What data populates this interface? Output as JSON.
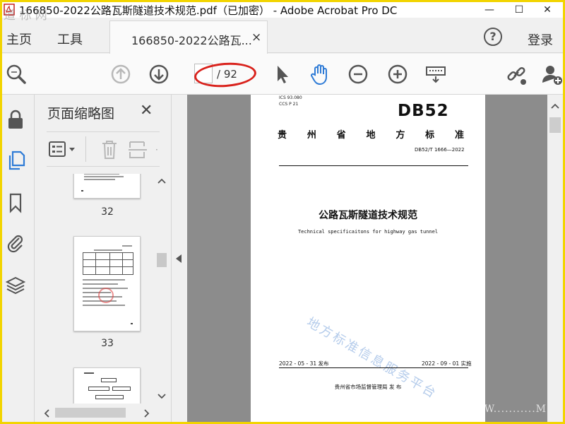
{
  "window": {
    "title": "166850-2022公路瓦斯隧道技术规范.pdf（已加密） - Adobe Acrobat Pro DC",
    "minimize": "—",
    "maximize": "☐",
    "close": "✕"
  },
  "tabs": {
    "home": "主页",
    "tools": "工具",
    "document": "166850-2022公路瓦...",
    "close": "×",
    "help": "?",
    "login": "登录"
  },
  "toolbar": {
    "page_current": "",
    "page_total": "/ 92",
    "icons": [
      "search-icon",
      "prev-page-icon",
      "next-page-icon",
      "select-arrow-icon",
      "hand-tool-icon",
      "zoom-out-icon",
      "zoom-in-icon",
      "keyboard-icon",
      "link-share-icon",
      "add-user-icon"
    ]
  },
  "thumbnails": {
    "title": "页面缩略图",
    "close": "✕",
    "pages": [
      "32",
      "33"
    ]
  },
  "document": {
    "ics": "ICS 93.080",
    "ccs": "CCS P 21",
    "standard_mark": "DB52",
    "province_chars": [
      "贵",
      "州",
      "省",
      "地",
      "方",
      "标",
      "准"
    ],
    "code": "DB52/T 1666—2022",
    "title": "公路瓦斯隧道技术规范",
    "english_title": "Technical specificaitons for highway gas tunnel",
    "watermark": "地方标准信息服务平台",
    "issue_date": "2022 - 05 - 31 发布",
    "effective_date": "2022 - 09 - 01 实施",
    "issuer": "贵州省市场监督管理局    发 布"
  },
  "overlay": {
    "corner_watermark": "道 标 网",
    "bottom_watermark": "WWW...........M"
  },
  "colors": {
    "frame": "#f2d400",
    "accent_blue": "#2e7bd6",
    "annotation_red": "#d9221c",
    "doc_background": "#8c8c8c"
  }
}
